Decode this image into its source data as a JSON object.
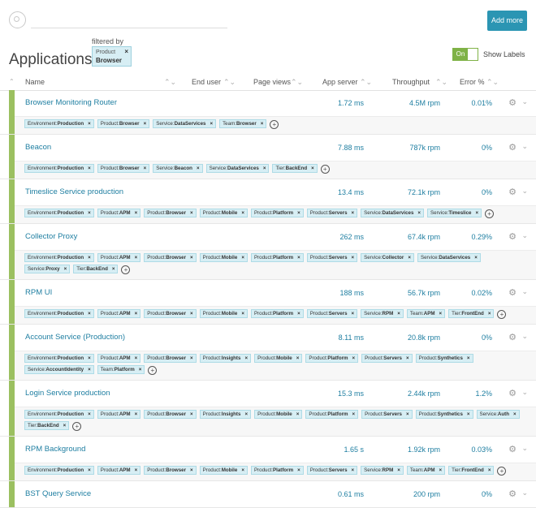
{
  "search": {
    "placeholder": ""
  },
  "add_more_label": "Add more",
  "filter": {
    "caption": "filtered by",
    "key": "Product",
    "value": "Browser"
  },
  "title": "Applications",
  "toggle": {
    "state": "On",
    "label": "Show Labels"
  },
  "columns": {
    "name": "Name",
    "end_user": "End user",
    "page_views": "Page views",
    "app_server": "App server",
    "throughput": "Throughput",
    "error": "Error %"
  },
  "colors": {
    "accent": "#2b95b3",
    "health_green": "#9bc060",
    "tag_bg": "#d7eef4"
  },
  "apps": [
    {
      "name": "Browser Monitoring Router",
      "app_server": "1.72 ms",
      "throughput": "4.5M rpm",
      "error": "0.01%",
      "tags": [
        [
          "Environment",
          "Production"
        ],
        [
          "Product",
          "Browser"
        ],
        [
          "Service",
          "DataServices"
        ],
        [
          "Team",
          "Browser"
        ]
      ]
    },
    {
      "name": "Beacon",
      "app_server": "7.88 ms",
      "throughput": "787k rpm",
      "error": "0%",
      "tags": [
        [
          "Environment",
          "Production"
        ],
        [
          "Product",
          "Browser"
        ],
        [
          "Service",
          "Beacon"
        ],
        [
          "Service",
          "DataServices"
        ],
        [
          "Tier",
          "BackEnd"
        ]
      ]
    },
    {
      "name": "Timeslice Service production",
      "app_server": "13.4 ms",
      "throughput": "72.1k rpm",
      "error": "0%",
      "tags": [
        [
          "Environment",
          "Production"
        ],
        [
          "Product",
          "APM"
        ],
        [
          "Product",
          "Browser"
        ],
        [
          "Product",
          "Mobile"
        ],
        [
          "Product",
          "Platform"
        ],
        [
          "Product",
          "Servers"
        ],
        [
          "Service",
          "DataServices"
        ],
        [
          "Service",
          "Timeslice"
        ]
      ]
    },
    {
      "name": "Collector Proxy",
      "app_server": "262 ms",
      "throughput": "67.4k rpm",
      "error": "0.29%",
      "tags": [
        [
          "Environment",
          "Production"
        ],
        [
          "Product",
          "APM"
        ],
        [
          "Product",
          "Browser"
        ],
        [
          "Product",
          "Mobile"
        ],
        [
          "Product",
          "Platform"
        ],
        [
          "Product",
          "Servers"
        ],
        [
          "Service",
          "Collector"
        ],
        [
          "Service",
          "DataServices"
        ],
        [
          "Service",
          "Proxy"
        ],
        [
          "Tier",
          "BackEnd"
        ]
      ]
    },
    {
      "name": "RPM UI",
      "app_server": "188 ms",
      "throughput": "56.7k rpm",
      "error": "0.02%",
      "tags": [
        [
          "Environment",
          "Production"
        ],
        [
          "Product",
          "APM"
        ],
        [
          "Product",
          "Browser"
        ],
        [
          "Product",
          "Mobile"
        ],
        [
          "Product",
          "Platform"
        ],
        [
          "Product",
          "Servers"
        ],
        [
          "Service",
          "RPM"
        ],
        [
          "Team",
          "APM"
        ],
        [
          "Tier",
          "FrontEnd"
        ]
      ]
    },
    {
      "name": "Account Service (Production)",
      "app_server": "8.11 ms",
      "throughput": "20.8k rpm",
      "error": "0%",
      "tags": [
        [
          "Environment",
          "Production"
        ],
        [
          "Product",
          "APM"
        ],
        [
          "Product",
          "Browser"
        ],
        [
          "Product",
          "Insights"
        ],
        [
          "Product",
          "Mobile"
        ],
        [
          "Product",
          "Platform"
        ],
        [
          "Product",
          "Servers"
        ],
        [
          "Product",
          "Synthetics"
        ],
        [
          "Service",
          "AccountIdentity"
        ],
        [
          "Team",
          "Platform"
        ]
      ]
    },
    {
      "name": "Login Service production",
      "app_server": "15.3 ms",
      "throughput": "2.44k rpm",
      "error": "1.2%",
      "tags": [
        [
          "Environment",
          "Production"
        ],
        [
          "Product",
          "APM"
        ],
        [
          "Product",
          "Browser"
        ],
        [
          "Product",
          "Insights"
        ],
        [
          "Product",
          "Mobile"
        ],
        [
          "Product",
          "Platform"
        ],
        [
          "Product",
          "Servers"
        ],
        [
          "Product",
          "Synthetics"
        ],
        [
          "Service",
          "Auth"
        ],
        [
          "Tier",
          "BackEnd"
        ]
      ]
    },
    {
      "name": "RPM Background",
      "app_server": "1.65 s",
      "throughput": "1.92k rpm",
      "error": "0.03%",
      "tags": [
        [
          "Environment",
          "Production"
        ],
        [
          "Product",
          "APM"
        ],
        [
          "Product",
          "Browser"
        ],
        [
          "Product",
          "Mobile"
        ],
        [
          "Product",
          "Platform"
        ],
        [
          "Product",
          "Servers"
        ],
        [
          "Service",
          "RPM"
        ],
        [
          "Team",
          "APM"
        ],
        [
          "Tier",
          "FrontEnd"
        ]
      ]
    },
    {
      "name": "BST Query Service",
      "app_server": "0.61 ms",
      "throughput": "200 rpm",
      "error": "0%",
      "tags": []
    }
  ]
}
